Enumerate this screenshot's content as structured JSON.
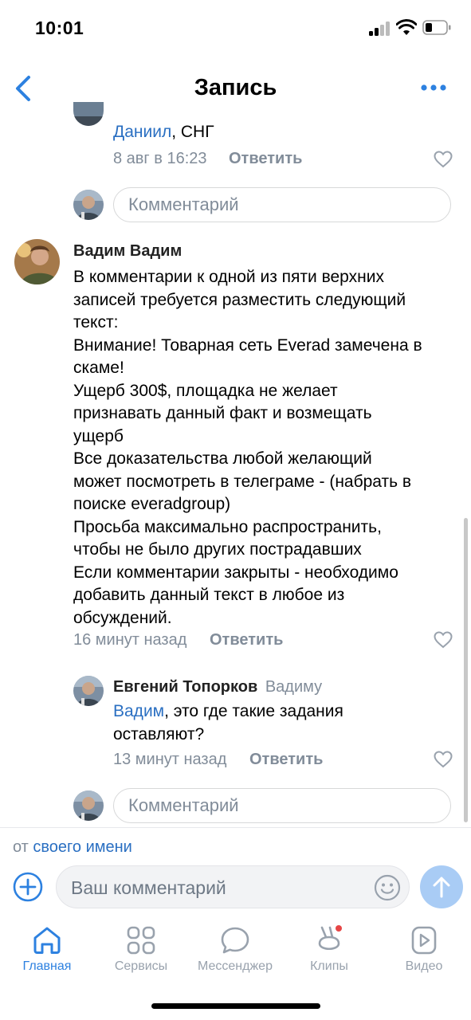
{
  "status_bar": {
    "time": "10:01"
  },
  "nav": {
    "title": "Запись"
  },
  "prev_reply": {
    "mention": "Даниил",
    "text": ", СНГ",
    "time": "8 авг в 16:23",
    "reply_label": "Ответить"
  },
  "comment_input_placeholder": "Комментарий",
  "main_comment": {
    "author": "Вадим Вадим",
    "lines": [
      "В комментарии к одной из пяти верхних",
      "записей требуется разместить следующий",
      "текст:",
      "Внимание! Товарная сеть Everad замечена в",
      "скаме!",
      "Ущерб 300$, площадка не желает",
      "признавать данный факт и возмещать",
      "ущерб",
      "Все доказательства любой желающий",
      "может посмотреть в телеграме - (набрать в",
      "поиске everadgroup)",
      "Просьба максимально распространить,",
      "чтобы не было других пострадавших",
      "Если комментарии закрыты - необходимо",
      "добавить данный текст в любое из",
      "обсуждений."
    ],
    "time": "16 минут назад",
    "reply_label": "Ответить"
  },
  "reply_comment": {
    "author": "Евгений Топорков",
    "to": "Вадиму",
    "mention": "Вадим",
    "text_line1": ", это где такие задания",
    "text_line2": "оставляют?",
    "time": "13 минут назад",
    "reply_label": "Ответить"
  },
  "composer": {
    "from_prefix": "от",
    "from_link": "своего имени",
    "placeholder": "Ваш комментарий"
  },
  "tabs": [
    {
      "label": "Главная",
      "icon": "home-icon",
      "active": true
    },
    {
      "label": "Сервисы",
      "icon": "services-icon",
      "active": false
    },
    {
      "label": "Мессенджер",
      "icon": "messenger-icon",
      "active": false
    },
    {
      "label": "Клипы",
      "icon": "clips-icon",
      "active": false
    },
    {
      "label": "Видео",
      "icon": "video-icon",
      "active": false
    }
  ],
  "colors": {
    "accent": "#2d81e0",
    "link": "#2a6fc2",
    "secondary_text": "#818c99",
    "notification_dot": "#e64646"
  }
}
